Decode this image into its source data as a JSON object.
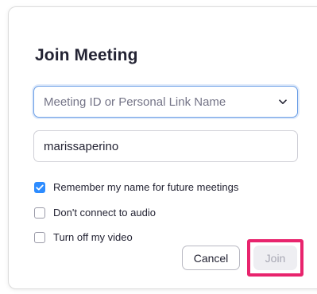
{
  "dialog": {
    "title": "Join Meeting",
    "meeting_select": {
      "placeholder": "Meeting ID or Personal Link Name",
      "icon": "chevron-down-icon"
    },
    "name_field": {
      "value": "marissaperino"
    },
    "options": [
      {
        "label": "Remember my name for future meetings",
        "checked": true
      },
      {
        "label": "Don't connect to audio",
        "checked": false
      },
      {
        "label": "Turn off my video",
        "checked": false
      }
    ],
    "buttons": {
      "cancel_label": "Cancel",
      "join_label": "Join"
    },
    "colors": {
      "accent": "#2d8cff",
      "focus_border": "#6a9ee6",
      "highlight": "#e8246d",
      "join_disabled_bg": "#eeeef2",
      "join_disabled_text": "#a7a7b3"
    }
  }
}
